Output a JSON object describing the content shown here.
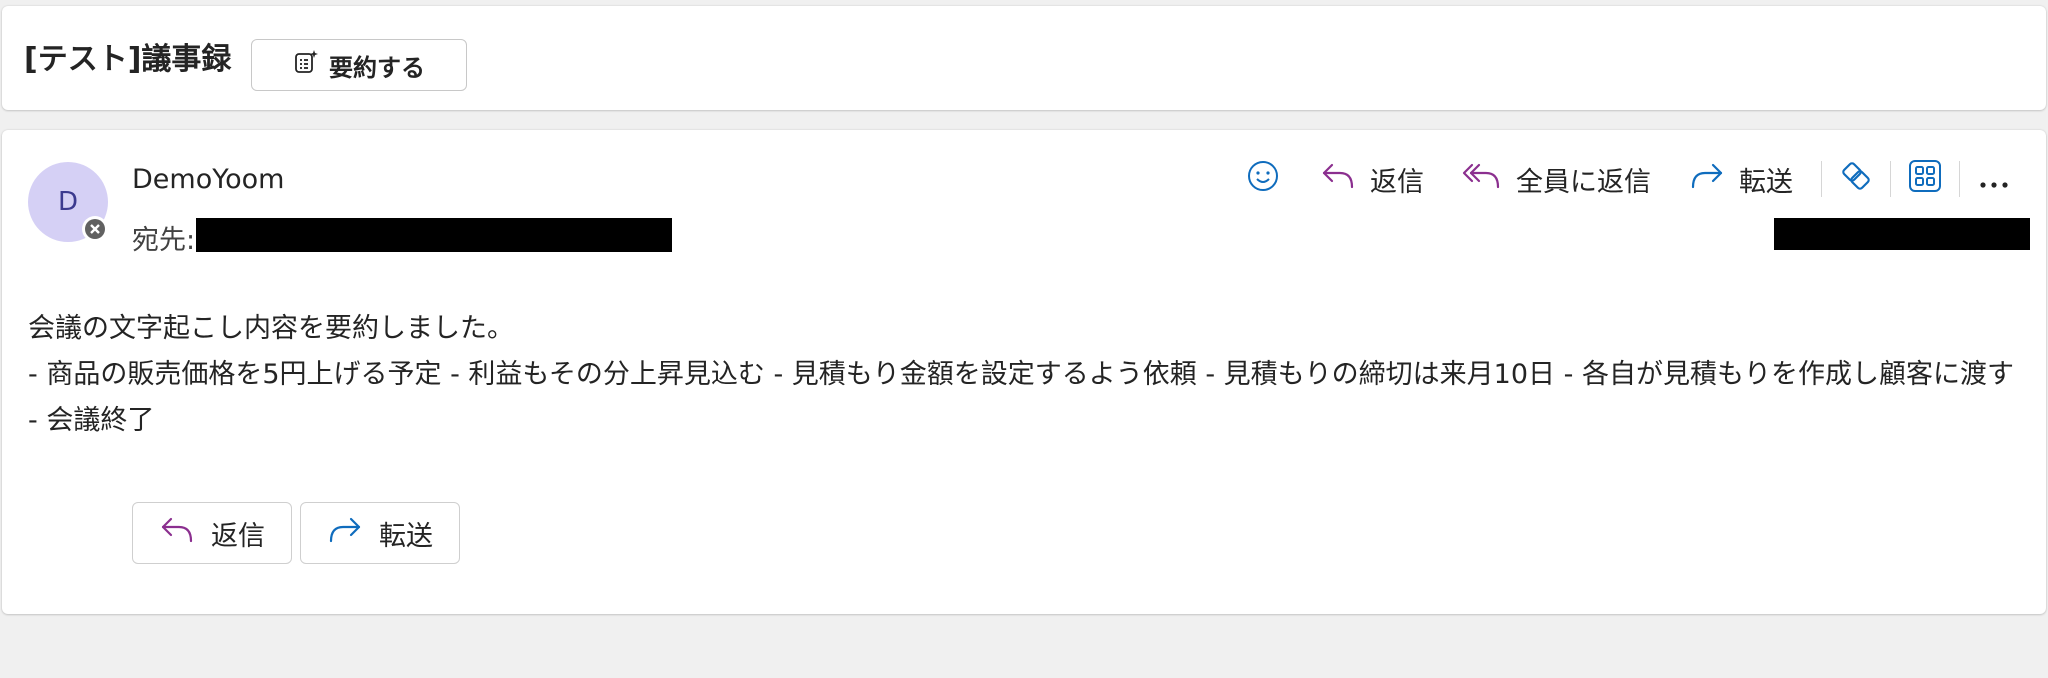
{
  "subject": {
    "title": "[テスト]議事録",
    "summarize_label": "要約する"
  },
  "message": {
    "avatar_initial": "D",
    "sender": "DemoYoom",
    "to_label": "宛先:",
    "actions": {
      "reply": "返信",
      "reply_all": "全員に返信",
      "forward": "転送"
    },
    "body_line1": "会議の文字起こし内容を要約しました。",
    "body_line2": "- 商品の販売価格を5円上げる予定 - 利益もその分上昇見込む - 見積もり金額を設定するよう依頼 - 見積もりの締切は来月10日 - 各自が見積もりを作成し顧客に渡す - 会議終了",
    "buttons": {
      "reply": "返信",
      "forward": "転送"
    }
  },
  "colors": {
    "accent_blue": "#0f6cbd",
    "accent_purple": "#8b2f8f",
    "avatar_bg": "#d5d0f5"
  }
}
